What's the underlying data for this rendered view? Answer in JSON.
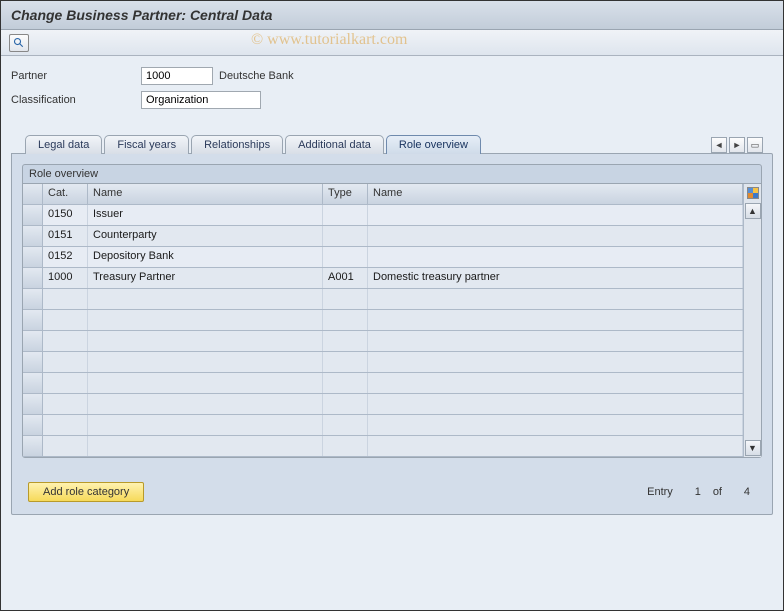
{
  "title": "Change Business Partner: Central Data",
  "watermark": "© www.tutorialkart.com",
  "form": {
    "partner_label": "Partner",
    "partner_id": "1000",
    "partner_name": "Deutsche Bank",
    "classification_label": "Classification",
    "classification_value": "Organization"
  },
  "tabs": [
    {
      "label": "Legal data"
    },
    {
      "label": "Fiscal years"
    },
    {
      "label": "Relationships"
    },
    {
      "label": "Additional data"
    },
    {
      "label": "Role overview",
      "active": true
    }
  ],
  "table": {
    "group_title": "Role overview",
    "columns": {
      "cat": "Cat.",
      "name1": "Name",
      "type": "Type",
      "name2": "Name"
    },
    "rows": [
      {
        "cat": "0150",
        "name1": "Issuer",
        "type": "",
        "name2": ""
      },
      {
        "cat": "0151",
        "name1": "Counterparty",
        "type": "",
        "name2": ""
      },
      {
        "cat": "0152",
        "name1": "Depository Bank",
        "type": "",
        "name2": ""
      },
      {
        "cat": "1000",
        "name1": "Treasury Partner",
        "type": "A001",
        "name2": "Domestic treasury partner"
      }
    ],
    "empty_rows": 8
  },
  "footer": {
    "add_button": "Add role category",
    "entry_label": "Entry",
    "entry_current": "1",
    "entry_of": "of",
    "entry_total": "4"
  }
}
